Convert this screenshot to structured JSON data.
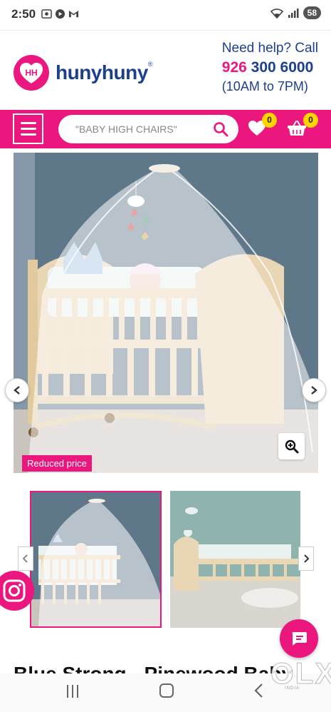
{
  "status_bar": {
    "time": "2:50",
    "battery": "58",
    "left_icons": [
      "screen-record-icon",
      "play-icon",
      "gmail-icon"
    ],
    "right_icons": [
      "wifi-icon",
      "signal-icon"
    ]
  },
  "header": {
    "logo_text": "hunyhuny",
    "logo_mark": "HH",
    "logo_reg": "®",
    "help_title": "Need help? Call",
    "help_phone_prefix": "926",
    "help_phone_rest": " 300 6000",
    "help_hours": "(10AM to 7PM)"
  },
  "nav": {
    "search_placeholder": "\"BABY HIGH CHAIRS\"",
    "wishlist_count": "0",
    "cart_count": "0"
  },
  "product": {
    "badge": "Reduced price",
    "title": "Blue Strong - Pinewood Baby"
  },
  "watermark": {
    "brand": "OLX",
    "sub": "INDIA"
  },
  "colors": {
    "brand_pink": "#ec167f",
    "brand_blue": "#1d3f8f",
    "badge_yellow": "#ffd400"
  }
}
